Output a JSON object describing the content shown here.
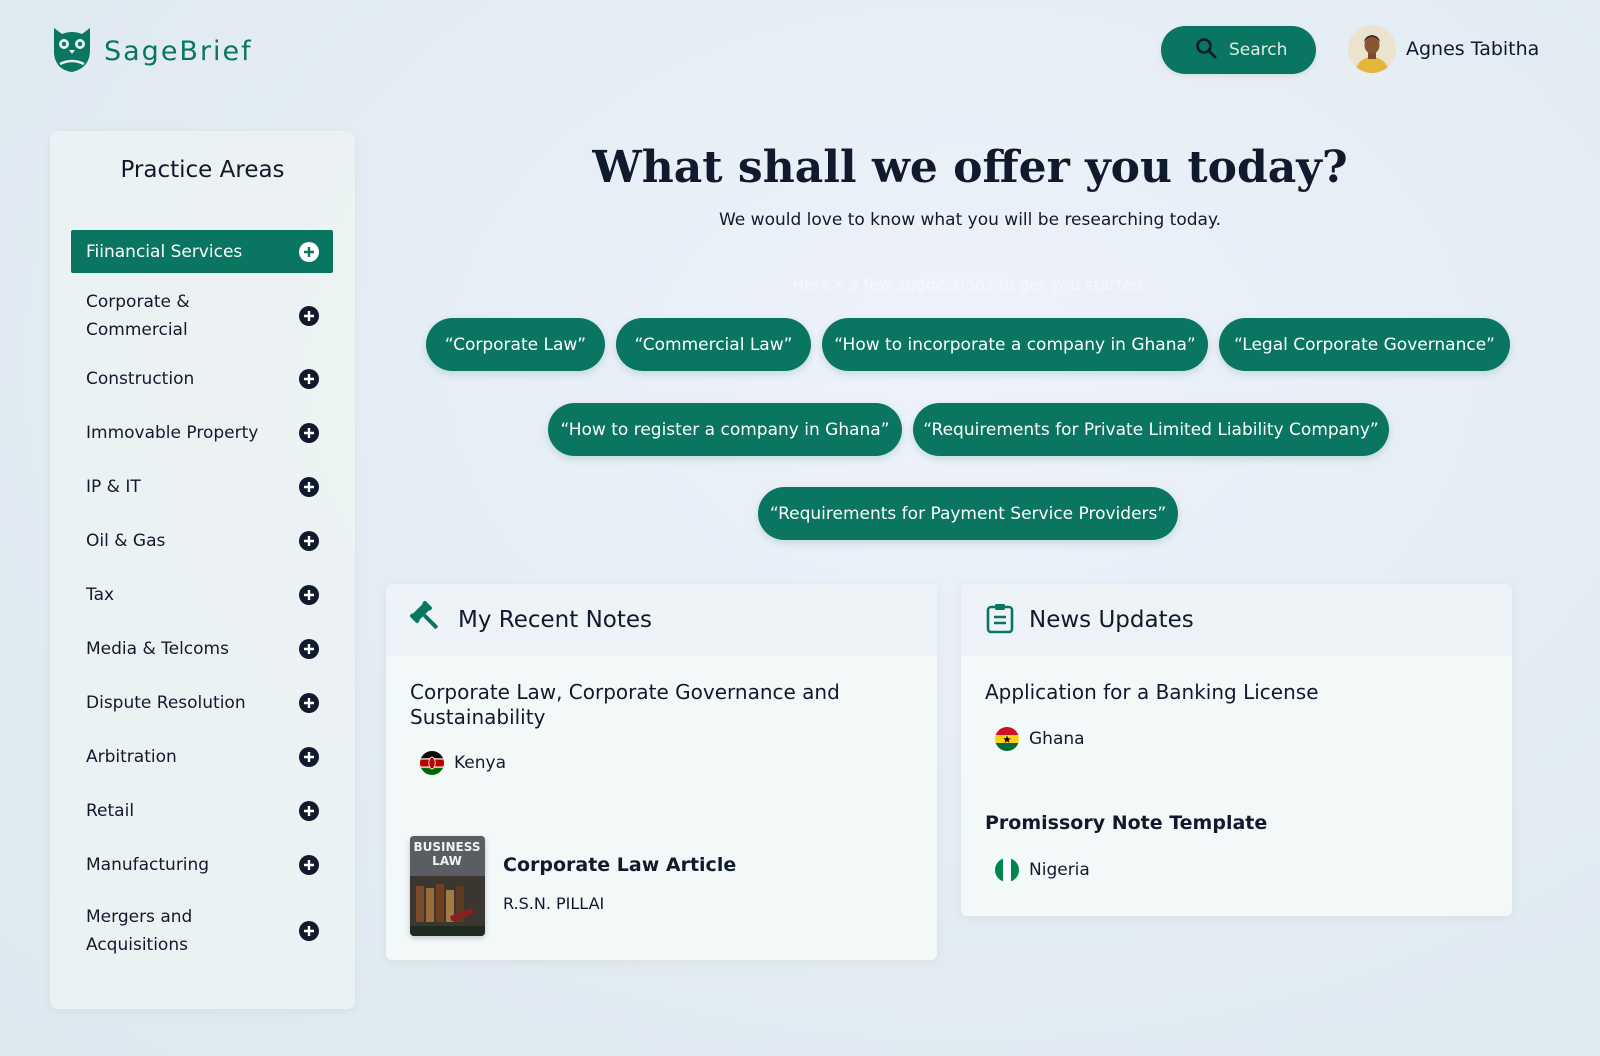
{
  "brand": {
    "name": "SageBrief",
    "color": "#0a7560",
    "icon": "owl-logo-icon"
  },
  "header": {
    "search_label": "Search",
    "user_name": "Agnes Tabitha"
  },
  "sidebar": {
    "title": "Practice Areas",
    "items": [
      {
        "label": "Fiinancial Services",
        "active": true
      },
      {
        "label": "Corporate & Commercial"
      },
      {
        "label": "Construction"
      },
      {
        "label": "Immovable Property"
      },
      {
        "label": "IP & IT"
      },
      {
        "label": "Oil & Gas"
      },
      {
        "label": "Tax"
      },
      {
        "label": "Media & Telcoms"
      },
      {
        "label": "Dispute Resolution"
      },
      {
        "label": "Arbitration"
      },
      {
        "label": "Retail"
      },
      {
        "label": "Manufacturing"
      },
      {
        "label": "Mergers and Acquisitions"
      }
    ]
  },
  "hero": {
    "title": "What shall we offer you today?",
    "subtitle": "We would love to know what you will be researching today.",
    "hint": "Here’s a few suggestions to get you started:"
  },
  "suggestions": [
    "“Corporate Law”",
    "“Commercial Law”",
    "“How to incorporate a company in Ghana”",
    "“Legal Corporate Governance”",
    "“How to register a company in Ghana”",
    "“Requirements for Private Limited Liability Company”",
    "“Requirements for Payment Service Providers”"
  ],
  "notes": {
    "title": "My Recent Notes",
    "icon": "gavel-icon",
    "note": {
      "title": "Corporate Law, Corporate Governance and Sustainability",
      "country": "Kenya"
    },
    "article": {
      "title": "Corporate Law Article",
      "author": "R.S.N. PILLAI",
      "cover_lines": [
        "BUSINESS",
        "LAW"
      ]
    }
  },
  "news": {
    "title": "News Updates",
    "icon": "clipboard-list-icon",
    "items": [
      {
        "title": "Application for a Banking License",
        "country": "Ghana"
      },
      {
        "title": "Promissory Note Template",
        "country": "Nigeria"
      }
    ]
  }
}
